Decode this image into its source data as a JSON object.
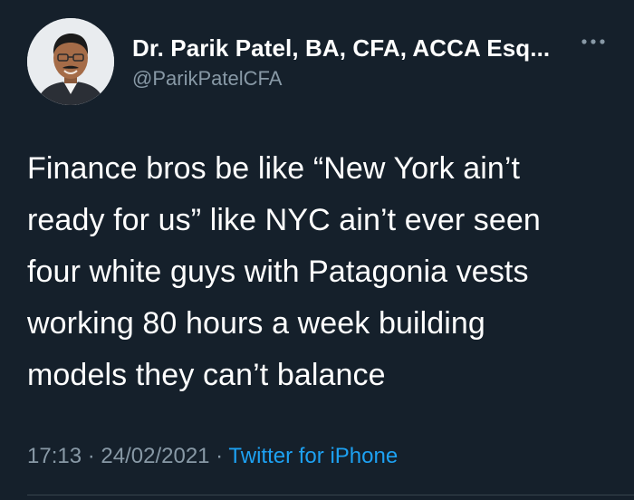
{
  "author": {
    "display_name": "Dr. Parik Patel, BA, CFA, ACCA Esq...",
    "handle": "@ParikPatelCFA",
    "avatar_icon": "profile-photo",
    "more_icon": "more-horizontal-icon"
  },
  "tweet": {
    "text_lines": [
      "Finance bros be like “New York ain’t",
      "ready for us” like NYC ain’t ever seen",
      "four white guys with Patagonia vests",
      "working 80 hours a week building",
      "models they can’t balance"
    ]
  },
  "meta": {
    "time": "17:13",
    "separator": " · ",
    "date": "24/02/2021",
    "source": "Twitter for iPhone"
  },
  "colors": {
    "background": "#15202b",
    "text": "#ffffff",
    "secondary": "#8899a6",
    "accent": "#1da1f2",
    "divider": "#38444d"
  }
}
